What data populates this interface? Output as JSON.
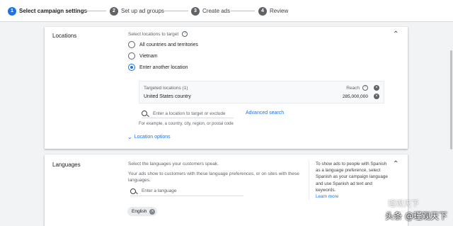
{
  "stepper": {
    "steps": [
      {
        "num": "1",
        "label": "Select campaign settings"
      },
      {
        "num": "2",
        "label": "Set up ad groups"
      },
      {
        "num": "3",
        "label": "Create ads"
      },
      {
        "num": "4",
        "label": "Review"
      }
    ]
  },
  "locations": {
    "title": "Locations",
    "select_label": "Select locations to target",
    "options": [
      "All countries and territories",
      "Vietnam",
      "Enter another location"
    ],
    "selected": "Enter another location",
    "targeted_header": "Targeted locations (1)",
    "reach_label": "Reach",
    "location_name": "United States country",
    "reach_value": "285,000,000",
    "search_placeholder": "Enter a location to target or exclude",
    "advanced_search": "Advanced search",
    "example_hint": "For example, a country, city, region, or postal code",
    "location_options": "Location options"
  },
  "languages": {
    "title": "Languages",
    "select_label": "Select the languages your customers speak.",
    "description": "Your ads show to customers with these language preferences, or on sites with these languages.",
    "search_placeholder": "Enter a language",
    "chip": "English",
    "side_note": "To show ads to people with Spanish as a language preference, select Spanish as your campaign language and use Spanish ad text and keywords.",
    "learn_more": "Learn more"
  },
  "watermark": {
    "text": "头条 @瑾观天下",
    "ghost_text": "瑾观天下"
  },
  "colors": {
    "accent": "#1a73e8",
    "background": "#f1f3f4"
  }
}
